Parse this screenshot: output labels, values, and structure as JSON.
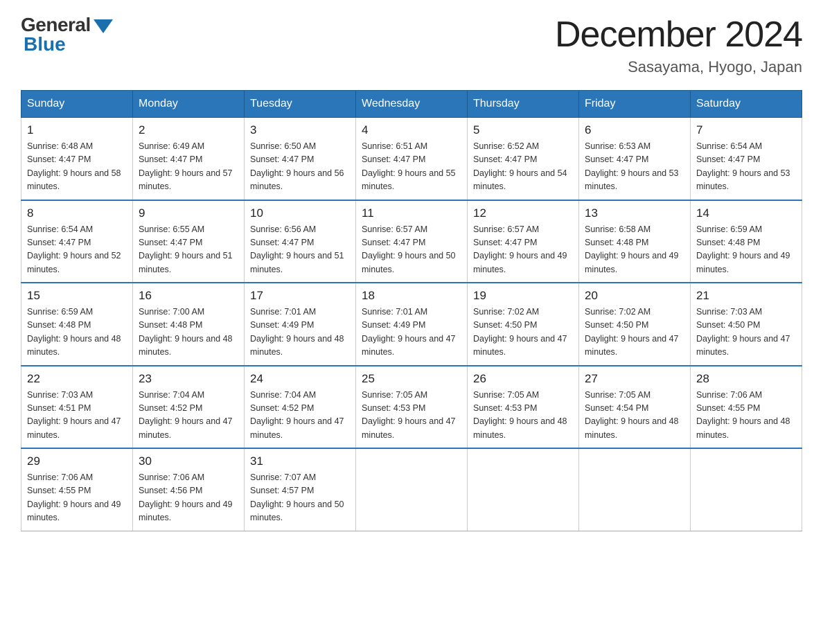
{
  "header": {
    "logo_general": "General",
    "logo_blue": "Blue",
    "month_title": "December 2024",
    "subtitle": "Sasayama, Hyogo, Japan"
  },
  "weekdays": [
    "Sunday",
    "Monday",
    "Tuesday",
    "Wednesday",
    "Thursday",
    "Friday",
    "Saturday"
  ],
  "weeks": [
    [
      {
        "day": "1",
        "sunrise": "6:48 AM",
        "sunset": "4:47 PM",
        "daylight": "9 hours and 58 minutes."
      },
      {
        "day": "2",
        "sunrise": "6:49 AM",
        "sunset": "4:47 PM",
        "daylight": "9 hours and 57 minutes."
      },
      {
        "day": "3",
        "sunrise": "6:50 AM",
        "sunset": "4:47 PM",
        "daylight": "9 hours and 56 minutes."
      },
      {
        "day": "4",
        "sunrise": "6:51 AM",
        "sunset": "4:47 PM",
        "daylight": "9 hours and 55 minutes."
      },
      {
        "day": "5",
        "sunrise": "6:52 AM",
        "sunset": "4:47 PM",
        "daylight": "9 hours and 54 minutes."
      },
      {
        "day": "6",
        "sunrise": "6:53 AM",
        "sunset": "4:47 PM",
        "daylight": "9 hours and 53 minutes."
      },
      {
        "day": "7",
        "sunrise": "6:54 AM",
        "sunset": "4:47 PM",
        "daylight": "9 hours and 53 minutes."
      }
    ],
    [
      {
        "day": "8",
        "sunrise": "6:54 AM",
        "sunset": "4:47 PM",
        "daylight": "9 hours and 52 minutes."
      },
      {
        "day": "9",
        "sunrise": "6:55 AM",
        "sunset": "4:47 PM",
        "daylight": "9 hours and 51 minutes."
      },
      {
        "day": "10",
        "sunrise": "6:56 AM",
        "sunset": "4:47 PM",
        "daylight": "9 hours and 51 minutes."
      },
      {
        "day": "11",
        "sunrise": "6:57 AM",
        "sunset": "4:47 PM",
        "daylight": "9 hours and 50 minutes."
      },
      {
        "day": "12",
        "sunrise": "6:57 AM",
        "sunset": "4:47 PM",
        "daylight": "9 hours and 49 minutes."
      },
      {
        "day": "13",
        "sunrise": "6:58 AM",
        "sunset": "4:48 PM",
        "daylight": "9 hours and 49 minutes."
      },
      {
        "day": "14",
        "sunrise": "6:59 AM",
        "sunset": "4:48 PM",
        "daylight": "9 hours and 49 minutes."
      }
    ],
    [
      {
        "day": "15",
        "sunrise": "6:59 AM",
        "sunset": "4:48 PM",
        "daylight": "9 hours and 48 minutes."
      },
      {
        "day": "16",
        "sunrise": "7:00 AM",
        "sunset": "4:48 PM",
        "daylight": "9 hours and 48 minutes."
      },
      {
        "day": "17",
        "sunrise": "7:01 AM",
        "sunset": "4:49 PM",
        "daylight": "9 hours and 48 minutes."
      },
      {
        "day": "18",
        "sunrise": "7:01 AM",
        "sunset": "4:49 PM",
        "daylight": "9 hours and 47 minutes."
      },
      {
        "day": "19",
        "sunrise": "7:02 AM",
        "sunset": "4:50 PM",
        "daylight": "9 hours and 47 minutes."
      },
      {
        "day": "20",
        "sunrise": "7:02 AM",
        "sunset": "4:50 PM",
        "daylight": "9 hours and 47 minutes."
      },
      {
        "day": "21",
        "sunrise": "7:03 AM",
        "sunset": "4:50 PM",
        "daylight": "9 hours and 47 minutes."
      }
    ],
    [
      {
        "day": "22",
        "sunrise": "7:03 AM",
        "sunset": "4:51 PM",
        "daylight": "9 hours and 47 minutes."
      },
      {
        "day": "23",
        "sunrise": "7:04 AM",
        "sunset": "4:52 PM",
        "daylight": "9 hours and 47 minutes."
      },
      {
        "day": "24",
        "sunrise": "7:04 AM",
        "sunset": "4:52 PM",
        "daylight": "9 hours and 47 minutes."
      },
      {
        "day": "25",
        "sunrise": "7:05 AM",
        "sunset": "4:53 PM",
        "daylight": "9 hours and 47 minutes."
      },
      {
        "day": "26",
        "sunrise": "7:05 AM",
        "sunset": "4:53 PM",
        "daylight": "9 hours and 48 minutes."
      },
      {
        "day": "27",
        "sunrise": "7:05 AM",
        "sunset": "4:54 PM",
        "daylight": "9 hours and 48 minutes."
      },
      {
        "day": "28",
        "sunrise": "7:06 AM",
        "sunset": "4:55 PM",
        "daylight": "9 hours and 48 minutes."
      }
    ],
    [
      {
        "day": "29",
        "sunrise": "7:06 AM",
        "sunset": "4:55 PM",
        "daylight": "9 hours and 49 minutes."
      },
      {
        "day": "30",
        "sunrise": "7:06 AM",
        "sunset": "4:56 PM",
        "daylight": "9 hours and 49 minutes."
      },
      {
        "day": "31",
        "sunrise": "7:07 AM",
        "sunset": "4:57 PM",
        "daylight": "9 hours and 50 minutes."
      },
      null,
      null,
      null,
      null
    ]
  ]
}
